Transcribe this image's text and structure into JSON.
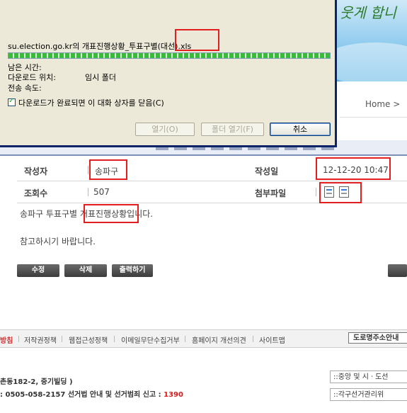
{
  "banner": {
    "slogan": "웃게 합니"
  },
  "breadcrumb": {
    "home": "Home >"
  },
  "post": {
    "author_label": "작성자",
    "author": "송파구",
    "date_label": "작성일",
    "date": "12-12-20 10:47",
    "views_label": "조회수",
    "views": "507",
    "attach_label": "첨부파일",
    "body_line1": "송파구 투표구별 개표진행상황입니다.",
    "body_line2": "참고하시기 바랍니다."
  },
  "actions": {
    "edit": "수정",
    "delete": "삭제",
    "print": "출력하기"
  },
  "footer": {
    "links": [
      "방침",
      "저작권정책",
      "웹접근성정책",
      "이메일무단수집거부",
      "홈페이지 개선의견",
      "사이트맵"
    ],
    "road_address": "도로명주소안내",
    "address": "촌동182-2, 중기빌딩 )",
    "phone_prefix": ": 0505-058-2157",
    "phone_desc": "선거법 안내 및 선거범죄 신고 :",
    "report_number": "1390",
    "select_central": "::중앙 및 시ㆍ도선",
    "select_local": "::각구선거관리위"
  },
  "download_dialog": {
    "filename": "su.election.go.kr의 개표진행상황_투표구별(대선).xls",
    "progress_percent": 100,
    "time_left_label": "남은 시간:",
    "location_label": "다운로드 위치:",
    "location_value": "임시 폴더",
    "speed_label": "전송 속도:",
    "close_checkbox_label": "다운로드가 완료되면 이 대화 상자를 닫음(C)",
    "close_checked": true,
    "open_button": "열기(O)",
    "open_folder_button": "폴더 열기(F)",
    "cancel_button": "취소"
  },
  "colors": {
    "highlight": "#e41e1e",
    "dialog_bg": "#ece9d8",
    "progress": "#3cba3c",
    "report_number": "#d21e1e"
  }
}
